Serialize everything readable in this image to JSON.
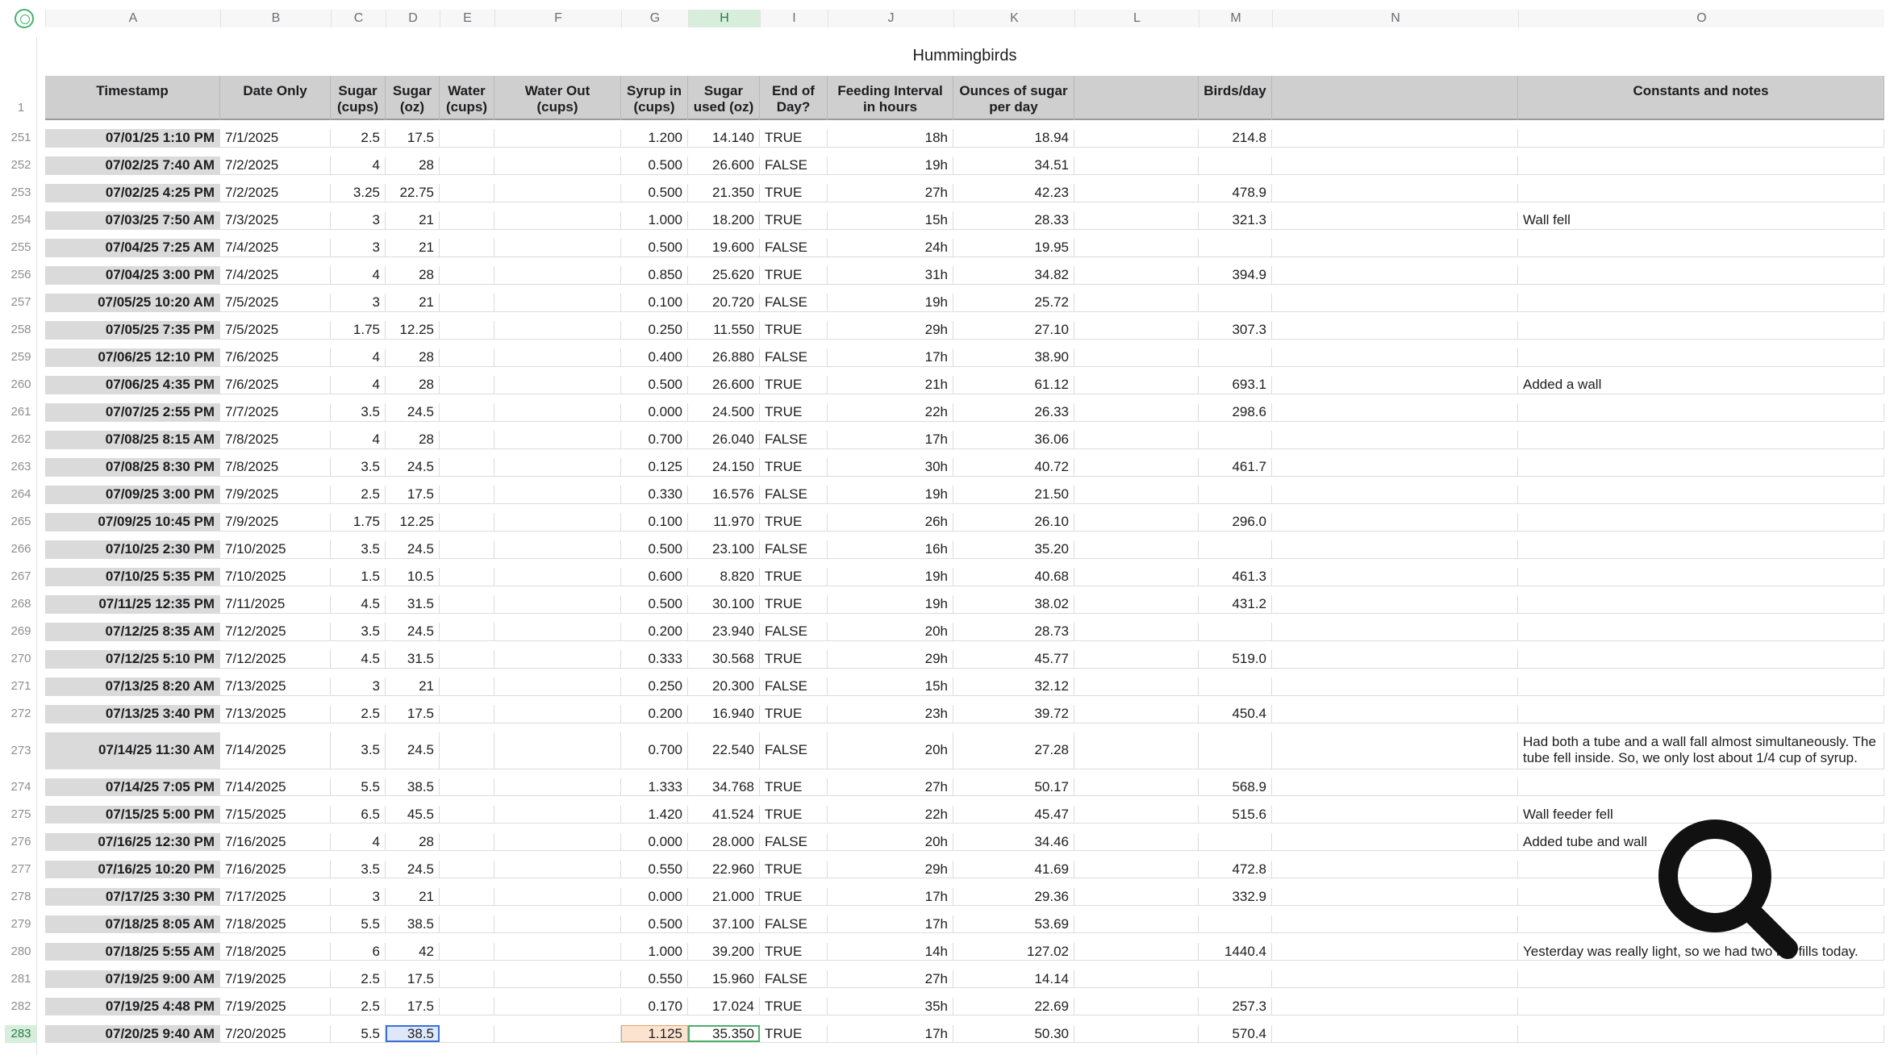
{
  "sheet": {
    "title": "Hummingbirds",
    "column_letters": [
      "A",
      "B",
      "C",
      "D",
      "E",
      "F",
      "G",
      "H",
      "I",
      "J",
      "K",
      "L",
      "M",
      "N",
      "O"
    ],
    "selected_column": "H",
    "header_row_number": "1",
    "headers": {
      "A": "Timestamp",
      "B": "Date Only",
      "C": "Sugar\n(cups)",
      "D": "Sugar\n(oz)",
      "E": "Water\n(cups)",
      "F": "Water Out\n(cups)",
      "G": "Syrup in\n(cups)",
      "H": "Sugar\nused (oz)",
      "I": "End of\nDay?",
      "J": "Feeding Interval\nin hours",
      "K": "Ounces of sugar\nper day",
      "L": "",
      "M": "Birds/day",
      "N": "",
      "O": "Constants and notes"
    },
    "rows": [
      {
        "n": "251",
        "ts": "07/01/25 1:10 PM",
        "date": "7/1/2025",
        "sc": "2.5",
        "so": "17.5",
        "syr": "1.200",
        "used": "14.140",
        "eod": "TRUE",
        "int": "18h",
        "ozd": "18.94",
        "bpd": "214.8",
        "note": ""
      },
      {
        "n": "252",
        "ts": "07/02/25 7:40 AM",
        "date": "7/2/2025",
        "sc": "4",
        "so": "28",
        "syr": "0.500",
        "used": "26.600",
        "eod": "FALSE",
        "int": "19h",
        "ozd": "34.51",
        "bpd": "",
        "note": ""
      },
      {
        "n": "253",
        "ts": "07/02/25 4:25 PM",
        "date": "7/2/2025",
        "sc": "3.25",
        "so": "22.75",
        "syr": "0.500",
        "used": "21.350",
        "eod": "TRUE",
        "int": "27h",
        "ozd": "42.23",
        "bpd": "478.9",
        "note": ""
      },
      {
        "n": "254",
        "ts": "07/03/25 7:50 AM",
        "date": "7/3/2025",
        "sc": "3",
        "so": "21",
        "syr": "1.000",
        "used": "18.200",
        "eod": "TRUE",
        "int": "15h",
        "ozd": "28.33",
        "bpd": "321.3",
        "note": "Wall fell"
      },
      {
        "n": "255",
        "ts": "07/04/25 7:25 AM",
        "date": "7/4/2025",
        "sc": "3",
        "so": "21",
        "syr": "0.500",
        "used": "19.600",
        "eod": "FALSE",
        "int": "24h",
        "ozd": "19.95",
        "bpd": "",
        "note": ""
      },
      {
        "n": "256",
        "ts": "07/04/25 3:00 PM",
        "date": "7/4/2025",
        "sc": "4",
        "so": "28",
        "syr": "0.850",
        "used": "25.620",
        "eod": "TRUE",
        "int": "31h",
        "ozd": "34.82",
        "bpd": "394.9",
        "note": ""
      },
      {
        "n": "257",
        "ts": "07/05/25 10:20 AM",
        "date": "7/5/2025",
        "sc": "3",
        "so": "21",
        "syr": "0.100",
        "used": "20.720",
        "eod": "FALSE",
        "int": "19h",
        "ozd": "25.72",
        "bpd": "",
        "note": ""
      },
      {
        "n": "258",
        "ts": "07/05/25 7:35 PM",
        "date": "7/5/2025",
        "sc": "1.75",
        "so": "12.25",
        "syr": "0.250",
        "used": "11.550",
        "eod": "TRUE",
        "int": "29h",
        "ozd": "27.10",
        "bpd": "307.3",
        "note": ""
      },
      {
        "n": "259",
        "ts": "07/06/25 12:10 PM",
        "date": "7/6/2025",
        "sc": "4",
        "so": "28",
        "syr": "0.400",
        "used": "26.880",
        "eod": "FALSE",
        "int": "17h",
        "ozd": "38.90",
        "bpd": "",
        "note": ""
      },
      {
        "n": "260",
        "ts": "07/06/25 4:35 PM",
        "date": "7/6/2025",
        "sc": "4",
        "so": "28",
        "syr": "0.500",
        "used": "26.600",
        "eod": "TRUE",
        "int": "21h",
        "ozd": "61.12",
        "bpd": "693.1",
        "note": "Added a wall"
      },
      {
        "n": "261",
        "ts": "07/07/25 2:55 PM",
        "date": "7/7/2025",
        "sc": "3.5",
        "so": "24.5",
        "syr": "0.000",
        "used": "24.500",
        "eod": "TRUE",
        "int": "22h",
        "ozd": "26.33",
        "bpd": "298.6",
        "note": ""
      },
      {
        "n": "262",
        "ts": "07/08/25 8:15 AM",
        "date": "7/8/2025",
        "sc": "4",
        "so": "28",
        "syr": "0.700",
        "used": "26.040",
        "eod": "FALSE",
        "int": "17h",
        "ozd": "36.06",
        "bpd": "",
        "note": ""
      },
      {
        "n": "263",
        "ts": "07/08/25 8:30 PM",
        "date": "7/8/2025",
        "sc": "3.5",
        "so": "24.5",
        "syr": "0.125",
        "used": "24.150",
        "eod": "TRUE",
        "int": "30h",
        "ozd": "40.72",
        "bpd": "461.7",
        "note": ""
      },
      {
        "n": "264",
        "ts": "07/09/25 3:00 PM",
        "date": "7/9/2025",
        "sc": "2.5",
        "so": "17.5",
        "syr": "0.330",
        "used": "16.576",
        "eod": "FALSE",
        "int": "19h",
        "ozd": "21.50",
        "bpd": "",
        "note": ""
      },
      {
        "n": "265",
        "ts": "07/09/25 10:45 PM",
        "date": "7/9/2025",
        "sc": "1.75",
        "so": "12.25",
        "syr": "0.100",
        "used": "11.970",
        "eod": "TRUE",
        "int": "26h",
        "ozd": "26.10",
        "bpd": "296.0",
        "note": ""
      },
      {
        "n": "266",
        "ts": "07/10/25 2:30 PM",
        "date": "7/10/2025",
        "sc": "3.5",
        "so": "24.5",
        "syr": "0.500",
        "used": "23.100",
        "eod": "FALSE",
        "int": "16h",
        "ozd": "35.20",
        "bpd": "",
        "note": ""
      },
      {
        "n": "267",
        "ts": "07/10/25 5:35 PM",
        "date": "7/10/2025",
        "sc": "1.5",
        "so": "10.5",
        "syr": "0.600",
        "used": "8.820",
        "eod": "TRUE",
        "int": "19h",
        "ozd": "40.68",
        "bpd": "461.3",
        "note": ""
      },
      {
        "n": "268",
        "ts": "07/11/25 12:35 PM",
        "date": "7/11/2025",
        "sc": "4.5",
        "so": "31.5",
        "syr": "0.500",
        "used": "30.100",
        "eod": "TRUE",
        "int": "19h",
        "ozd": "38.02",
        "bpd": "431.2",
        "note": ""
      },
      {
        "n": "269",
        "ts": "07/12/25 8:35 AM",
        "date": "7/12/2025",
        "sc": "3.5",
        "so": "24.5",
        "syr": "0.200",
        "used": "23.940",
        "eod": "FALSE",
        "int": "20h",
        "ozd": "28.73",
        "bpd": "",
        "note": ""
      },
      {
        "n": "270",
        "ts": "07/12/25 5:10 PM",
        "date": "7/12/2025",
        "sc": "4.5",
        "so": "31.5",
        "syr": "0.333",
        "used": "30.568",
        "eod": "TRUE",
        "int": "29h",
        "ozd": "45.77",
        "bpd": "519.0",
        "note": ""
      },
      {
        "n": "271",
        "ts": "07/13/25 8:20 AM",
        "date": "7/13/2025",
        "sc": "3",
        "so": "21",
        "syr": "0.250",
        "used": "20.300",
        "eod": "FALSE",
        "int": "15h",
        "ozd": "32.12",
        "bpd": "",
        "note": ""
      },
      {
        "n": "272",
        "ts": "07/13/25 3:40 PM",
        "date": "7/13/2025",
        "sc": "2.5",
        "so": "17.5",
        "syr": "0.200",
        "used": "16.940",
        "eod": "TRUE",
        "int": "23h",
        "ozd": "39.72",
        "bpd": "450.4",
        "note": ""
      },
      {
        "n": "273",
        "ts": "07/14/25 11:30 AM",
        "date": "7/14/2025",
        "sc": "3.5",
        "so": "24.5",
        "syr": "0.700",
        "used": "22.540",
        "eod": "FALSE",
        "int": "20h",
        "ozd": "27.28",
        "bpd": "",
        "note": "Had both a tube and a wall fall almost simultaneously. The tube fell inside. So, we only lost about 1/4 cup of syrup.",
        "tall": true
      },
      {
        "n": "274",
        "ts": "07/14/25 7:05 PM",
        "date": "7/14/2025",
        "sc": "5.5",
        "so": "38.5",
        "syr": "1.333",
        "used": "34.768",
        "eod": "TRUE",
        "int": "27h",
        "ozd": "50.17",
        "bpd": "568.9",
        "note": ""
      },
      {
        "n": "275",
        "ts": "07/15/25 5:00 PM",
        "date": "7/15/2025",
        "sc": "6.5",
        "so": "45.5",
        "syr": "1.420",
        "used": "41.524",
        "eod": "TRUE",
        "int": "22h",
        "ozd": "45.47",
        "bpd": "515.6",
        "note": "Wall feeder fell"
      },
      {
        "n": "276",
        "ts": "07/16/25 12:30 PM",
        "date": "7/16/2025",
        "sc": "4",
        "so": "28",
        "syr": "0.000",
        "used": "28.000",
        "eod": "FALSE",
        "int": "20h",
        "ozd": "34.46",
        "bpd": "",
        "note": "Added tube and wall"
      },
      {
        "n": "277",
        "ts": "07/16/25 10:20 PM",
        "date": "7/16/2025",
        "sc": "3.5",
        "so": "24.5",
        "syr": "0.550",
        "used": "22.960",
        "eod": "TRUE",
        "int": "29h",
        "ozd": "41.69",
        "bpd": "472.8",
        "note": ""
      },
      {
        "n": "278",
        "ts": "07/17/25 3:30 PM",
        "date": "7/17/2025",
        "sc": "3",
        "so": "21",
        "syr": "0.000",
        "used": "21.000",
        "eod": "TRUE",
        "int": "17h",
        "ozd": "29.36",
        "bpd": "332.9",
        "note": ""
      },
      {
        "n": "279",
        "ts": "07/18/25 8:05 AM",
        "date": "7/18/2025",
        "sc": "5.5",
        "so": "38.5",
        "syr": "0.500",
        "used": "37.100",
        "eod": "FALSE",
        "int": "17h",
        "ozd": "53.69",
        "bpd": "",
        "note": ""
      },
      {
        "n": "280",
        "ts": "07/18/25 5:55 AM",
        "date": "7/18/2025",
        "sc": "6",
        "so": "42",
        "syr": "1.000",
        "used": "39.200",
        "eod": "TRUE",
        "int": "14h",
        "ozd": "127.02",
        "bpd": "1440.4",
        "note": "Yesterday was really light, so we had two big fills today."
      },
      {
        "n": "281",
        "ts": "07/19/25 9:00 AM",
        "date": "7/19/2025",
        "sc": "2.5",
        "so": "17.5",
        "syr": "0.550",
        "used": "15.960",
        "eod": "FALSE",
        "int": "27h",
        "ozd": "14.14",
        "bpd": "",
        "note": ""
      },
      {
        "n": "282",
        "ts": "07/19/25 4:48 PM",
        "date": "7/19/2025",
        "sc": "2.5",
        "so": "17.5",
        "syr": "0.170",
        "used": "17.024",
        "eod": "TRUE",
        "int": "35h",
        "ozd": "22.69",
        "bpd": "257.3",
        "note": ""
      },
      {
        "n": "283",
        "ts": "07/20/25 9:40 AM",
        "date": "7/20/2025",
        "sc": "5.5",
        "so": "38.5",
        "syr": "1.125",
        "used": "35.350",
        "eod": "TRUE",
        "int": "17h",
        "ozd": "50.30",
        "bpd": "570.4",
        "note": "",
        "selected": true
      }
    ]
  },
  "overlay": {
    "icon": "magnifier-icon"
  }
}
